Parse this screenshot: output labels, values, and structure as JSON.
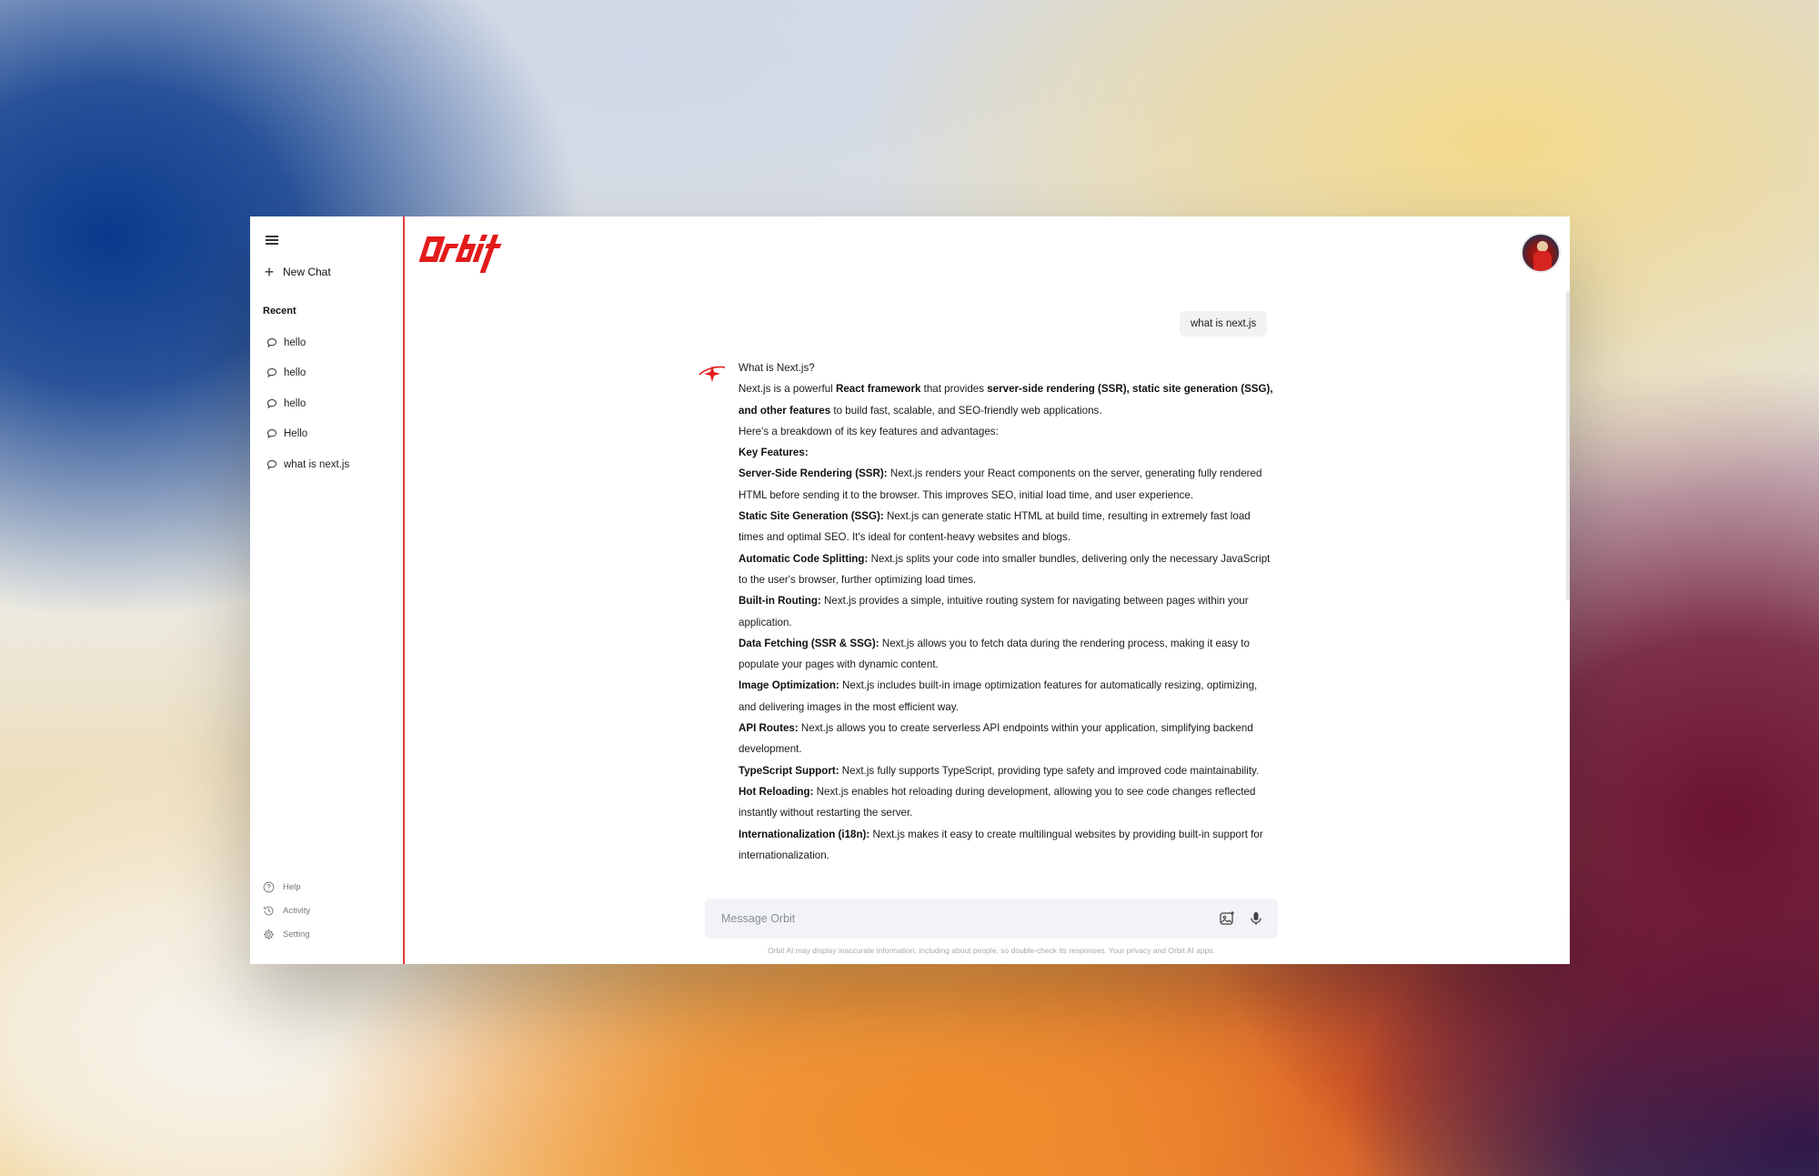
{
  "brand": {
    "name": "Orbit",
    "accent": "#e31b1b"
  },
  "sidebar": {
    "new_chat": "New Chat",
    "recent_title": "Recent",
    "recent": [
      {
        "label": "hello"
      },
      {
        "label": "hello"
      },
      {
        "label": "hello"
      },
      {
        "label": "Hello"
      },
      {
        "label": "what is next.js"
      }
    ],
    "bottom": [
      {
        "label": "Help",
        "icon": "help-icon"
      },
      {
        "label": "Activity",
        "icon": "activity-icon"
      },
      {
        "label": "Setting",
        "icon": "gear-icon"
      }
    ]
  },
  "chat": {
    "user_message": "what is next.js",
    "answer": {
      "title": "What is Next.js?",
      "intro_parts": [
        "Next.js is a powerful ",
        "React framework",
        " that provides ",
        "server-side rendering (SSR), static site generation (SSG), and other features",
        " to build fast, scalable, and SEO-friendly web applications."
      ],
      "breakdown": "Here's a breakdown of its key features and advantages:",
      "features_heading": "Key Features:",
      "features": [
        {
          "name": "Server-Side Rendering (SSR):",
          "desc": " Next.js renders your React components on the server, generating fully rendered HTML before sending it to the browser. This improves SEO, initial load time, and user experience."
        },
        {
          "name": "Static Site Generation (SSG):",
          "desc": " Next.js can generate static HTML at build time, resulting in extremely fast load times and optimal SEO. It's ideal for content-heavy websites and blogs."
        },
        {
          "name": "Automatic Code Splitting:",
          "desc": " Next.js splits your code into smaller bundles, delivering only the necessary JavaScript to the user's browser, further optimizing load times."
        },
        {
          "name": "Built-in Routing:",
          "desc": " Next.js provides a simple, intuitive routing system for navigating between pages within your application."
        },
        {
          "name": "Data Fetching (SSR & SSG):",
          "desc": " Next.js allows you to fetch data during the rendering process, making it easy to populate your pages with dynamic content."
        },
        {
          "name": "Image Optimization:",
          "desc": " Next.js includes built-in image optimization features for automatically resizing, optimizing, and delivering images in the most efficient way."
        },
        {
          "name": "API Routes:",
          "desc": " Next.js allows you to create serverless API endpoints within your application, simplifying backend development."
        },
        {
          "name": "TypeScript Support:",
          "desc": " Next.js fully supports TypeScript, providing type safety and improved code maintainability."
        },
        {
          "name": "Hot Reloading:",
          "desc": " Next.js enables hot reloading during development, allowing you to see code changes reflected instantly without restarting the server."
        },
        {
          "name": "Internationalization (i18n):",
          "desc": " Next.js makes it easy to create multilingual websites by providing built-in support for internationalization."
        }
      ]
    }
  },
  "composer": {
    "placeholder": "Message Orbit",
    "disclaimer": "Orbit AI may display inaccurate information, including about people, so double-check its responses. Your privacy and Orbit AI apps."
  }
}
